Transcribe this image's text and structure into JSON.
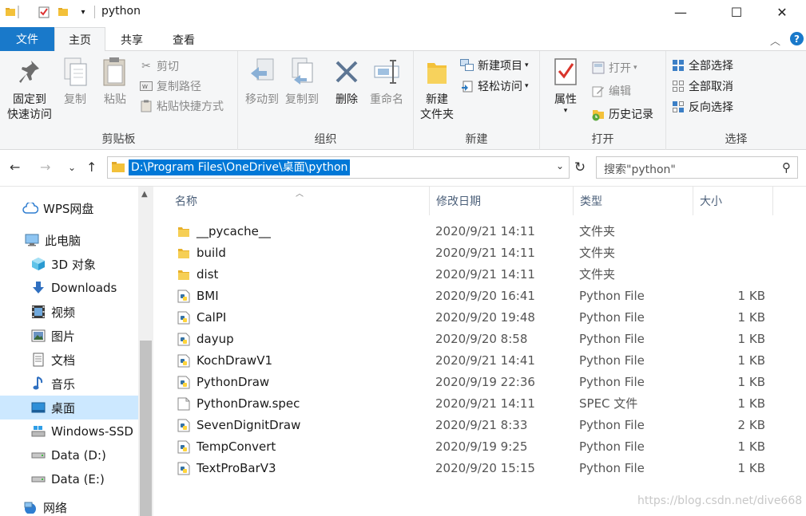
{
  "window": {
    "title": "python",
    "minimize": "—",
    "maximize": "☐",
    "close": "✕"
  },
  "tabs": {
    "file": "文件",
    "home": "主页",
    "share": "共享",
    "view": "查看"
  },
  "ribbon": {
    "clipboard": {
      "label": "剪贴板",
      "pin": [
        "固定到",
        "快速访问"
      ],
      "copy": "复制",
      "paste": "粘贴",
      "cut": "剪切",
      "copy_path": "复制路径",
      "paste_shortcut": "粘贴快捷方式"
    },
    "organize": {
      "label": "组织",
      "move_to": "移动到",
      "copy_to": "复制到",
      "delete": "删除",
      "rename": "重命名"
    },
    "new": {
      "label": "新建",
      "new_folder": [
        "新建",
        "文件夹"
      ],
      "new_item": "新建项目",
      "easy_access": "轻松访问"
    },
    "open": {
      "label": "打开",
      "properties": "属性",
      "open": "打开",
      "edit": "编辑",
      "history": "历史记录"
    },
    "select": {
      "label": "选择",
      "select_all": "全部选择",
      "select_none": "全部取消",
      "invert": "反向选择"
    }
  },
  "address": {
    "path": "D:\\Program Files\\OneDrive\\桌面\\python",
    "search_placeholder": "搜索\"python\""
  },
  "nav": {
    "items": [
      {
        "label": "WPS网盘",
        "icon": "cloud-icon"
      },
      {
        "label": "此电脑",
        "icon": "computer-icon"
      },
      {
        "label": "3D 对象",
        "icon": "cube-icon"
      },
      {
        "label": "Downloads",
        "icon": "download-icon"
      },
      {
        "label": "视频",
        "icon": "video-icon"
      },
      {
        "label": "图片",
        "icon": "picture-icon"
      },
      {
        "label": "文档",
        "icon": "document-icon"
      },
      {
        "label": "音乐",
        "icon": "music-icon"
      },
      {
        "label": "桌面",
        "icon": "desktop-icon",
        "selected": true
      },
      {
        "label": "Windows-SSD (",
        "icon": "windows-drive-icon"
      },
      {
        "label": "Data (D:)",
        "icon": "drive-icon"
      },
      {
        "label": "Data (E:)",
        "icon": "drive-icon"
      },
      {
        "label": "网络",
        "icon": "network-icon"
      }
    ]
  },
  "columns": {
    "name": "名称",
    "date": "修改日期",
    "type": "类型",
    "size": "大小"
  },
  "files": [
    {
      "name": "__pycache__",
      "date": "2020/9/21 14:11",
      "type": "文件夹",
      "size": "",
      "icon": "folder-icon"
    },
    {
      "name": "build",
      "date": "2020/9/21 14:11",
      "type": "文件夹",
      "size": "",
      "icon": "folder-icon"
    },
    {
      "name": "dist",
      "date": "2020/9/21 14:11",
      "type": "文件夹",
      "size": "",
      "icon": "folder-icon"
    },
    {
      "name": "BMI",
      "date": "2020/9/20 16:41",
      "type": "Python File",
      "size": "1 KB",
      "icon": "python-file-icon"
    },
    {
      "name": "CalPI",
      "date": "2020/9/20 19:48",
      "type": "Python File",
      "size": "1 KB",
      "icon": "python-file-icon"
    },
    {
      "name": "dayup",
      "date": "2020/9/20 8:58",
      "type": "Python File",
      "size": "1 KB",
      "icon": "python-file-icon"
    },
    {
      "name": "KochDrawV1",
      "date": "2020/9/21 14:41",
      "type": "Python File",
      "size": "1 KB",
      "icon": "python-file-icon"
    },
    {
      "name": "PythonDraw",
      "date": "2020/9/19 22:36",
      "type": "Python File",
      "size": "1 KB",
      "icon": "python-file-icon"
    },
    {
      "name": "PythonDraw.spec",
      "date": "2020/9/21 14:11",
      "type": "SPEC 文件",
      "size": "1 KB",
      "icon": "blank-file-icon"
    },
    {
      "name": "SevenDignitDraw",
      "date": "2020/9/21 8:33",
      "type": "Python File",
      "size": "2 KB",
      "icon": "python-file-icon"
    },
    {
      "name": "TempConvert",
      "date": "2020/9/19 9:25",
      "type": "Python File",
      "size": "1 KB",
      "icon": "python-file-icon"
    },
    {
      "name": "TextProBarV3",
      "date": "2020/9/20 15:15",
      "type": "Python File",
      "size": "1 KB",
      "icon": "python-file-icon"
    }
  ],
  "watermark": "https://blog.csdn.net/dive668",
  "colors": {
    "accent": "#1979ca",
    "selection": "#cce8ff",
    "folder": "#f3c13a",
    "python_blue": "#3572a5",
    "python_yellow": "#ffd43b"
  }
}
